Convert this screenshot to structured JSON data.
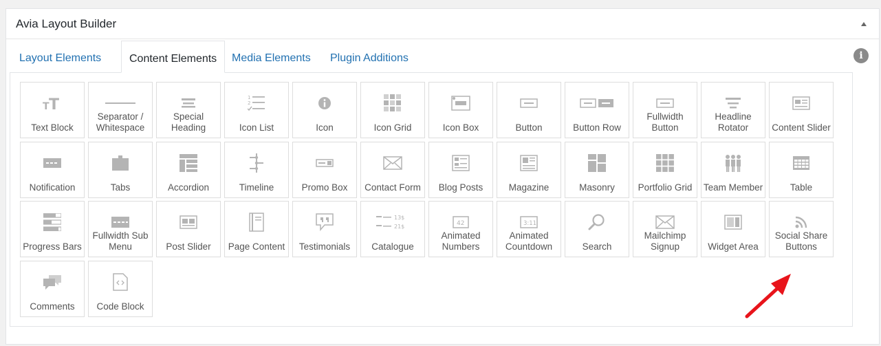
{
  "panel": {
    "title": "Avia Layout Builder"
  },
  "tabs": [
    {
      "label": "Layout Elements",
      "active": false
    },
    {
      "label": "Content Elements",
      "active": true
    },
    {
      "label": "Media Elements",
      "active": false
    },
    {
      "label": "Plugin Additions",
      "active": false
    }
  ],
  "elements": [
    {
      "label": "Text Block",
      "icon": "text-block-icon"
    },
    {
      "label": "Separator / Whitespace",
      "icon": "separator-icon"
    },
    {
      "label": "Special Heading",
      "icon": "heading-icon"
    },
    {
      "label": "Icon List",
      "icon": "icon-list-icon"
    },
    {
      "label": "Icon",
      "icon": "info-circle-icon"
    },
    {
      "label": "Icon Grid",
      "icon": "icon-grid-icon"
    },
    {
      "label": "Icon Box",
      "icon": "icon-box-icon"
    },
    {
      "label": "Button",
      "icon": "button-icon"
    },
    {
      "label": "Button Row",
      "icon": "button-row-icon"
    },
    {
      "label": "Fullwidth Button",
      "icon": "fullwidth-button-icon"
    },
    {
      "label": "Headline Rotator",
      "icon": "headline-rotator-icon"
    },
    {
      "label": "Content Slider",
      "icon": "content-slider-icon"
    },
    {
      "label": "Notification",
      "icon": "notification-icon"
    },
    {
      "label": "Tabs",
      "icon": "tabs-icon"
    },
    {
      "label": "Accordion",
      "icon": "accordion-icon"
    },
    {
      "label": "Timeline",
      "icon": "timeline-icon"
    },
    {
      "label": "Promo Box",
      "icon": "promo-box-icon"
    },
    {
      "label": "Contact Form",
      "icon": "envelope-icon"
    },
    {
      "label": "Blog Posts",
      "icon": "blog-posts-icon"
    },
    {
      "label": "Magazine",
      "icon": "magazine-icon"
    },
    {
      "label": "Masonry",
      "icon": "masonry-icon"
    },
    {
      "label": "Portfolio Grid",
      "icon": "portfolio-grid-icon"
    },
    {
      "label": "Team Member",
      "icon": "team-member-icon"
    },
    {
      "label": "Table",
      "icon": "table-icon"
    },
    {
      "label": "Progress Bars",
      "icon": "progress-bars-icon"
    },
    {
      "label": "Fullwidth Sub Menu",
      "icon": "sub-menu-icon"
    },
    {
      "label": "Post Slider",
      "icon": "post-slider-icon"
    },
    {
      "label": "Page Content",
      "icon": "page-content-icon"
    },
    {
      "label": "Testimonials",
      "icon": "testimonials-icon"
    },
    {
      "label": "Catalogue",
      "icon": "catalogue-icon"
    },
    {
      "label": "Animated Numbers",
      "icon": "animated-numbers-icon"
    },
    {
      "label": "Animated Countdown",
      "icon": "countdown-icon"
    },
    {
      "label": "Search",
      "icon": "search-icon"
    },
    {
      "label": "Mailchimp Signup",
      "icon": "mailchimp-envelope-icon"
    },
    {
      "label": "Widget Area",
      "icon": "widget-area-icon"
    },
    {
      "label": "Social Share Buttons",
      "icon": "social-share-icon"
    },
    {
      "label": "Comments",
      "icon": "comments-icon"
    },
    {
      "label": "Code Block",
      "icon": "code-block-icon"
    }
  ],
  "icon_glyphs": {
    "catalogue_price_1": "13$",
    "catalogue_price_2": "21$",
    "animated_number": "42",
    "countdown_time": "3:11"
  },
  "colors": {
    "accent": "#2271b1",
    "icon_gray": "#b4b4b4",
    "arrow_red": "#e8141b"
  }
}
